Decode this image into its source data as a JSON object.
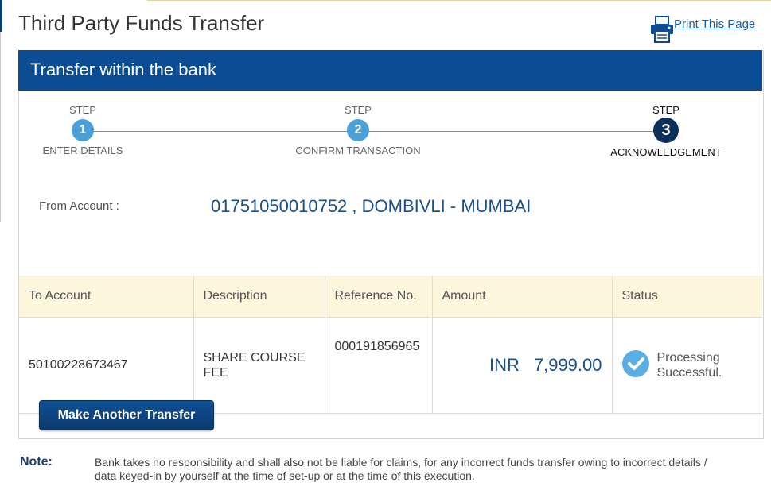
{
  "page": {
    "title": "Third Party Funds Transfer",
    "print_label": "Print This Page"
  },
  "panel": {
    "header": "Transfer within the bank"
  },
  "steps": [
    {
      "caption": "STEP",
      "number": "1",
      "label": "ENTER DETAILS",
      "active": false
    },
    {
      "caption": "STEP",
      "number": "2",
      "label": "CONFIRM TRANSACTION",
      "active": false
    },
    {
      "caption": "STEP",
      "number": "3",
      "label": "ACKNOWLEDGEMENT",
      "active": true
    }
  ],
  "from_account": {
    "label": "From Account :",
    "value": "01751050010752 , DOMBIVLI - MUMBAI"
  },
  "table": {
    "headers": [
      "To Account",
      "Description",
      "Reference No.",
      "Amount",
      "Status"
    ],
    "row": {
      "to_account": "50100228673467",
      "description": "SHARE COURSE FEE",
      "reference": "000191856965",
      "currency": "INR",
      "amount": "7,999.00",
      "status_line1": "Processing",
      "status_line2": "Successful."
    }
  },
  "actions": {
    "make_another_transfer": "Make Another Transfer"
  },
  "note": {
    "label": "Note:",
    "text": "Bank takes no responsibility and shall also not be liable for claims, for any incorrect funds transfer owing to incorrect details / data keyed-in by yourself at the time of set-up or at the time of this execution."
  },
  "colors": {
    "header_bg": "#0a4d94",
    "step_circle": "#4aa0d8",
    "step_active": "#0c2f5c",
    "table_header_bg": "#fdf5dc",
    "status_check": "#5aaee6"
  },
  "icons": {
    "print": "printer-icon",
    "status": "check-circle-icon"
  }
}
